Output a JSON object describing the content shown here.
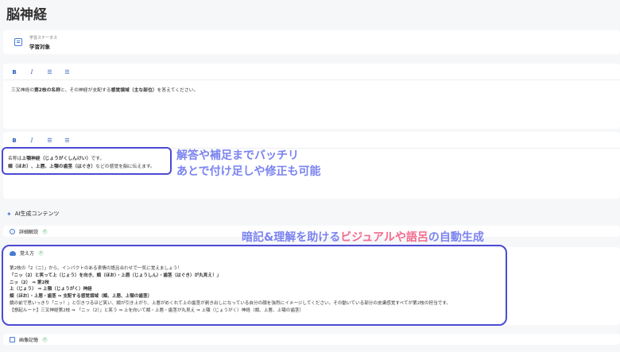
{
  "page": {
    "title": "脳神経"
  },
  "status": {
    "label": "学習ステータス",
    "value": "学習対象"
  },
  "toolbar": {
    "bold": "B",
    "italic": "I",
    "bullet_list": "☰",
    "numbered_list": "☰"
  },
  "question": {
    "pre": "三叉神経の",
    "b1": "第2枝の名称",
    "mid": "と、その神経が支配する",
    "b2": "感覚領域（主な部位）",
    "post": "を答えてください。"
  },
  "answer": {
    "line1_pre": "名称は",
    "line1_bold": "上顎神経（じょうがくしんけい）",
    "line1_post": "です。",
    "line2_bold": "頬（ほお）、上唇、上顎の歯茎（はぐき）",
    "line2_post": "などの感覚を脳に伝えます。"
  },
  "callouts": {
    "line1": "解答や補足までバッチリ",
    "line2": "あとで付け足しや修正も可能",
    "generation_pre": "暗記&理解を助ける",
    "generation_red": "ビジュアルや語呂",
    "generation_post": "の自動生成"
  },
  "ai_section": {
    "title": "AI生成コンテンツ"
  },
  "cards": {
    "details": {
      "title": "詳細解説",
      "check": "✓"
    },
    "memorize": {
      "title": "覚え方",
      "check": "✓",
      "lines": [
        "第2枝の「2（ニ）」から、インパクトのある表情の語呂合わせで一気に覚えましょう！",
        "「ニッ（2）と笑って上（じょう）を向き、頬（ほお）・上唇（じょうしん）・歯茎（はぐき）が丸見え！」",
        "ニッ（2） ⇒ 第2枝",
        "上（じょう） ⇒ 上顎（じょうがく）神経",
        "頬（ほお）・上唇・歯茎 ⇒ 支配する感覚領域（頬、上唇、上顎の歯茎）",
        "鏡の前で思いっきり「ニッ！」と引きつるほど笑い、頬が引き上がり、上唇がめくれて上の歯茎が剥き出しになっている自分の顔を強烈にイメージしてください。その動いている部分の皮膚感覚すべてが第2枝の担当です。",
        "【想起ルート】三叉神経第2枝 ⇒ 「ニッ（2）」と笑う ⇒ 上を向いて頬・上唇・歯茎が丸見え ⇒ 上顎（じょうがく）神経（頬、上唇、上顎の歯茎）"
      ]
    },
    "image": {
      "title": "画像記憶",
      "check": "✓"
    }
  },
  "colors": {
    "accent": "#4b4bd4",
    "callout": "#7a83f0",
    "highlight": "#f26a8d",
    "icon": "#4a7bd0"
  }
}
